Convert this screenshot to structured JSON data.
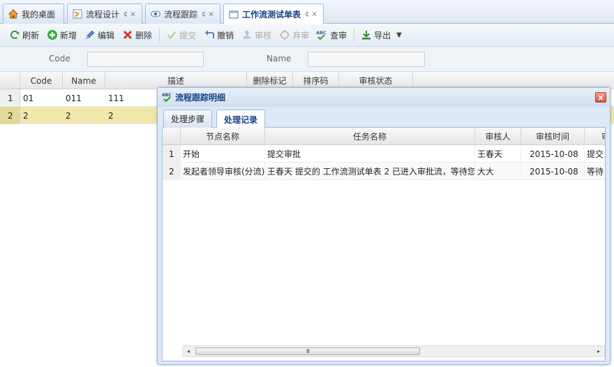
{
  "tabs": [
    {
      "label": "我的桌面",
      "icon": "home-icon",
      "closable": false
    },
    {
      "label": "流程设计",
      "icon": "design-icon",
      "closable": true
    },
    {
      "label": "流程跟踪",
      "icon": "eye-icon",
      "closable": true
    },
    {
      "label": "工作流测试单表",
      "icon": "window-icon",
      "closable": true,
      "active": true
    }
  ],
  "tab_controls": {
    "refresh": "¢",
    "close": "×"
  },
  "toolbar": {
    "refresh": "刷新",
    "add": "新增",
    "edit": "编辑",
    "delete": "删除",
    "submit": "提交",
    "revoke": "撤销",
    "audit": "审核",
    "abandon": "弃审",
    "check": "查审",
    "export": "导出"
  },
  "search": {
    "code_label": "Code",
    "code_value": "",
    "name_label": "Name",
    "name_value": ""
  },
  "grid": {
    "columns": [
      "Code",
      "Name",
      "描述",
      "删除标记",
      "排序码",
      "审核状态"
    ],
    "rows": [
      {
        "num": "1",
        "code": "01",
        "name": "011",
        "desc": "111"
      },
      {
        "num": "2",
        "code": "2",
        "name": "2",
        "desc": "2",
        "selected": true
      }
    ]
  },
  "dialog": {
    "title": "流程跟踪明细",
    "icon_text": "ABC",
    "close_glyph": "x",
    "tabs": [
      "处理步骤",
      "处理记录"
    ],
    "active_tab": "处理记录",
    "columns": [
      "节点名称",
      "任务名称",
      "审核人",
      "审核时间",
      "审"
    ],
    "rows": [
      {
        "num": "1",
        "node": "开始",
        "task": "提交审批",
        "reviewer": "王春天",
        "time": "2015-10-08",
        "more": "提交"
      },
      {
        "num": "2",
        "node": "发起者领导审核(分流)",
        "task": "王春天 提交的 工作流测试单表 2 已进入审批流，等待您",
        "reviewer": "大大",
        "time": "2015-10-08",
        "more": "等待"
      }
    ],
    "scrollbar": {
      "left": "◂",
      "right": "▸",
      "grip": "III"
    }
  },
  "colors": {
    "accent": "#15428b",
    "border": "#99bbe8",
    "selected_row": "#f1e7ab"
  }
}
